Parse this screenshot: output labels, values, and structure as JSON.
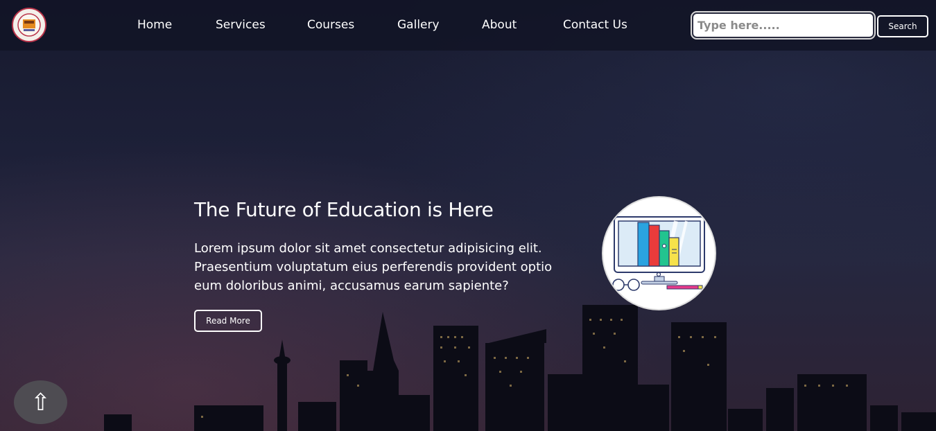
{
  "nav": {
    "logo_icon": "institution-logo",
    "links": [
      "Home",
      "Services",
      "Courses",
      "Gallery",
      "About",
      "Contact Us"
    ]
  },
  "search": {
    "placeholder": "Type here.....",
    "value": "",
    "button_label": "Search"
  },
  "hero": {
    "title": "The Future of Education is Here",
    "text": "Lorem ipsum dolor sit amet consectetur adipisicing elit. Praesentium voluptatum eius perferendis provident optio eum doloribus animi, accusamus earum sapiente?",
    "button_label": "Read More",
    "image_icon": "computer-books-illustration"
  },
  "scroll_top": {
    "icon": "arrow-up-icon",
    "glyph": "⇧"
  },
  "colors": {
    "nav_background": "#12142a",
    "sky_top": "#171a2e",
    "sky_bottom": "#2e2233",
    "text": "#ffffff",
    "logo_border": "#b9344a"
  }
}
